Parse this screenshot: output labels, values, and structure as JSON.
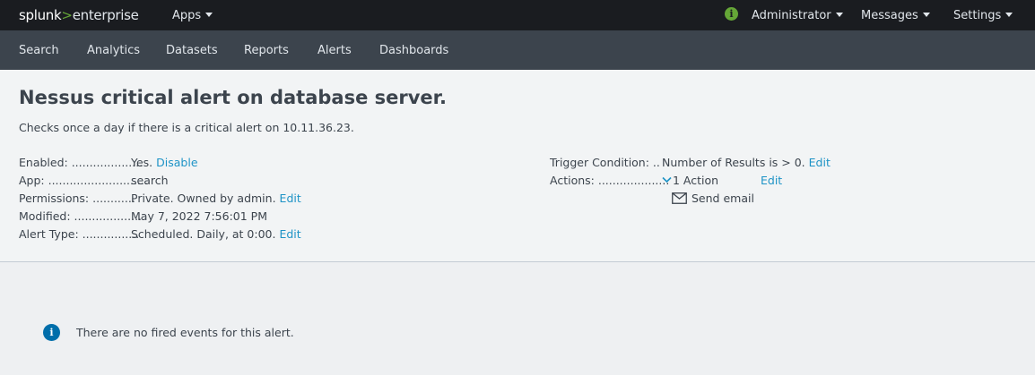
{
  "topbar": {
    "logo_brand": "splunk",
    "logo_gt": ">",
    "logo_product": "enterprise",
    "apps_label": "Apps",
    "health_glyph": "i",
    "admin_label": "Administrator",
    "messages_label": "Messages",
    "settings_label": "Settings"
  },
  "appbar": {
    "items": [
      "Search",
      "Analytics",
      "Datasets",
      "Reports",
      "Alerts",
      "Dashboards"
    ]
  },
  "alert": {
    "title": "Nessus critical alert on database server.",
    "description": "Checks once a day if there is a critical alert on 10.11.36.23."
  },
  "details_left": {
    "enabled_label": "Enabled: ....................",
    "enabled_value": "Yes.",
    "enabled_action": "Disable",
    "app_label": "App: ............................",
    "app_value": "search",
    "permissions_label": "Permissions: ............",
    "permissions_value": "Private. Owned by admin.",
    "permissions_action": "Edit",
    "modified_label": "Modified: ...................",
    "modified_value": "May 7, 2022 7:56:01 PM",
    "alert_type_label": "Alert Type: ................",
    "alert_type_value": "Scheduled. Daily, at 0:00.",
    "alert_type_action": "Edit"
  },
  "details_right": {
    "trigger_label": "Trigger Condition: ..",
    "trigger_value": "Number of Results is > 0.",
    "trigger_action": "Edit",
    "actions_label": "Actions: ....................",
    "actions_value": "1 Action",
    "actions_action": "Edit",
    "send_email_label": "Send email"
  },
  "events": {
    "info_glyph": "i",
    "empty_message": "There are no fired events for this alert."
  },
  "colors": {
    "topbar_bg": "#1a1c20",
    "appbar_bg": "#3c444d",
    "link": "#1e93c6",
    "brand_green": "#65a637",
    "info_blue": "#006eaa"
  }
}
